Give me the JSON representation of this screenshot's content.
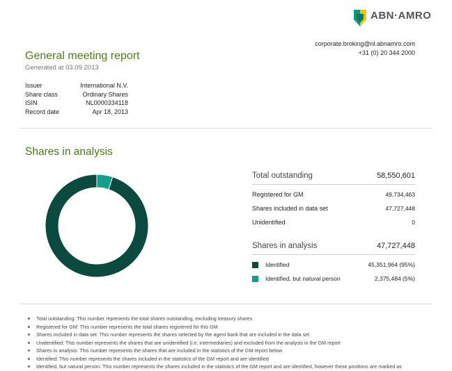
{
  "brand": {
    "name": "ABN·AMRO",
    "colors": {
      "green": "#0d9a7e",
      "yellow": "#f5c400"
    }
  },
  "contact": {
    "email": "corporate.broking@nl.abnamro.com",
    "phone": "+31 (0) 20 344 2000"
  },
  "report": {
    "title": "General meeting report",
    "generated": "Generated at 03.09.2013"
  },
  "info": [
    {
      "label": "Issuer",
      "value": "International N.V."
    },
    {
      "label": "Share class",
      "value": "Ordinary Shares"
    },
    {
      "label": "ISIN",
      "value": "NL0000334118"
    },
    {
      "label": "Record date",
      "value": "Apr 18, 2013"
    }
  ],
  "analysis": {
    "title": "Shares in analysis",
    "total_outstanding": {
      "label": "Total outstanding",
      "value": "58,550,601"
    },
    "registered": {
      "label": "Registered for GM",
      "value": "49,734,463"
    },
    "included": {
      "label": "Shares included in data set",
      "value": "47,727,448"
    },
    "unidentified": {
      "label": "Unidentified",
      "value": "0"
    },
    "in_analysis": {
      "label": "Shares in analysis",
      "value": "47,727,448"
    },
    "legend": [
      {
        "label": "Identified",
        "value": "45,351,964 (95%)",
        "color": "#0b4a3e"
      },
      {
        "label": "Identified, but natural person",
        "value": "2,375,484 (5%)",
        "color": "#12a08d"
      }
    ]
  },
  "chart_data": {
    "type": "pie",
    "categories": [
      "Identified",
      "Identified, but natural person"
    ],
    "values": [
      45351964,
      2375484
    ],
    "colors": [
      "#0b4a3e",
      "#12a08d"
    ],
    "donut": true
  },
  "notes": [
    "Total outstanding: This number represents the total shares outstanding, excluding treasury shares",
    "Registered for GM: This number represents the total shares registered for this GM",
    "Shares included in data set: This number represents the shares selected by the agent bank that are included in the data set",
    "Unidentified: This number represents the shares that are unidentified (i.e. intermediaries) and excluded from the analysis in the GM report",
    "Shares in analysis: This number represents the shares that are included in the statistics of the GM report below",
    "Identified: This number represents the shares included in the statistics of the GM report and are identified",
    "Identified, but natural person: This number represents the shares included in the statistics of the GM report and are identified, however these positions are marked as"
  ]
}
